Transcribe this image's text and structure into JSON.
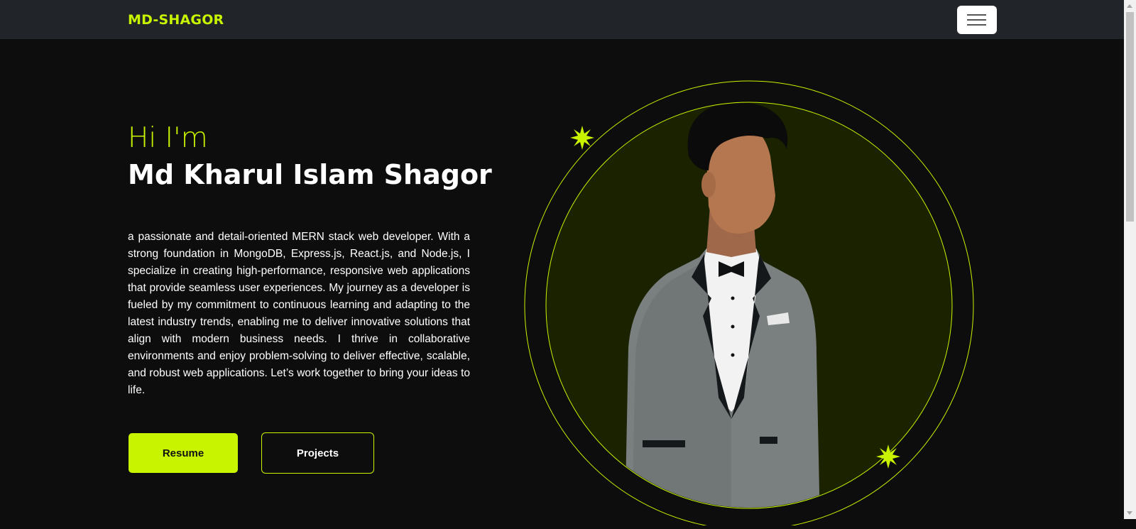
{
  "navbar": {
    "brand": "MD-SHAGOR",
    "menu_icon": "hamburger-icon"
  },
  "hero": {
    "greeting": "Hi I'm",
    "name": "Md Kharul Islam Shagor",
    "bio": "a passionate and detail-oriented MERN stack web developer. With a strong foundation in MongoDB, Express.js, React.js, and Node.js, I specialize in creating high-performance, responsive web applications that provide seamless user experiences. My journey as a developer is fueled by my commitment to continuous learning and adapting to the latest industry trends, enabling me to deliver innovative solutions that align with modern business needs. I thrive in collaborative environments and enjoy problem-solving to deliver effective, scalable, and robust web applications. Let’s work together to bring your ideas to life.",
    "resume_label": "Resume",
    "projects_label": "Projects"
  },
  "colors": {
    "accent": "#c8f400",
    "background": "#0d0d0d",
    "navbar": "#212529",
    "circle_fill": "#1b2200"
  },
  "icons": [
    "hamburger-icon",
    "sparkle-icon",
    "profile-photo"
  ]
}
